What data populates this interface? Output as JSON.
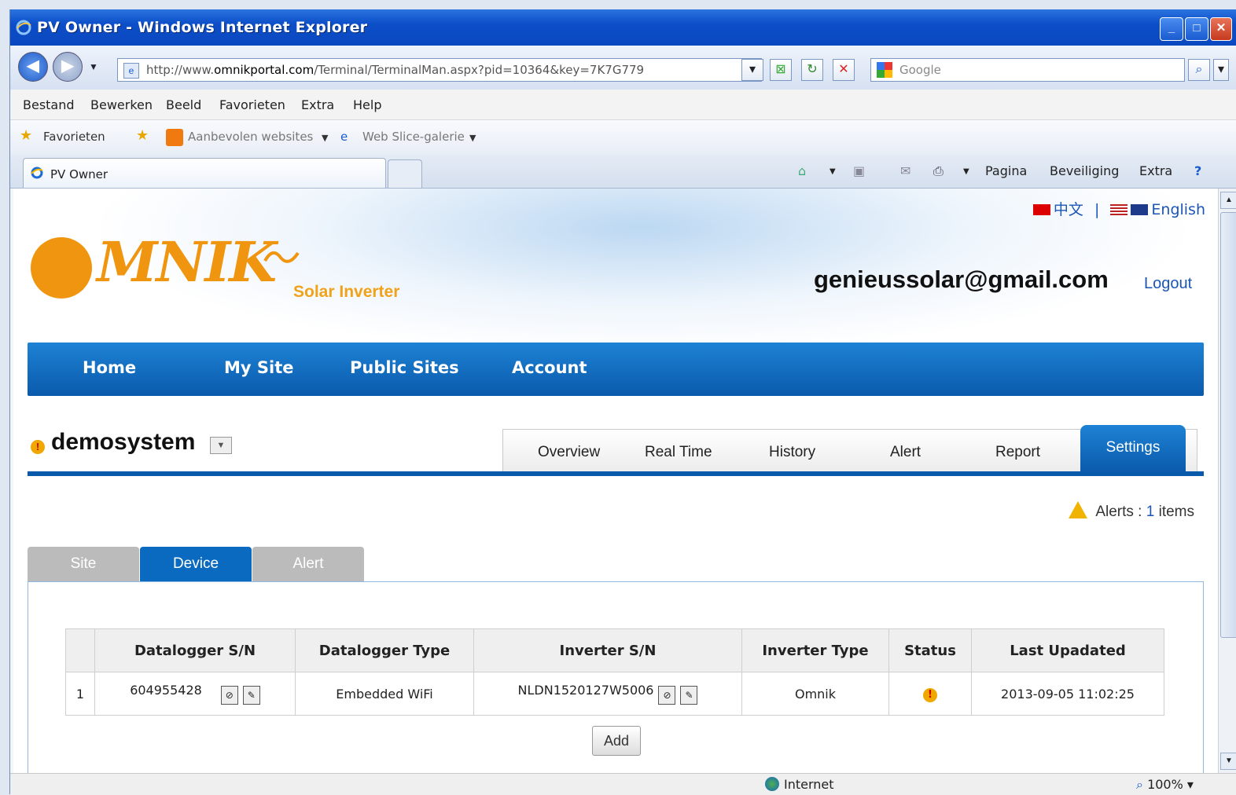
{
  "window": {
    "title": "PV Owner - Windows Internet Explorer"
  },
  "address": {
    "url_pre": "http://www.",
    "url_domain": "omnikportal.com",
    "url_post": "/Terminal/TerminalMan.aspx?pid=10364&key=7K7G779",
    "search_placeholder": "Google"
  },
  "menubar": {
    "items": [
      "Bestand",
      "Bewerken",
      "Beeld",
      "Favorieten",
      "Extra",
      "Help"
    ]
  },
  "favbar": {
    "favorites": "Favorieten",
    "suggested": "Aanbevolen websites",
    "webslice": "Web Slice-galerie"
  },
  "tabbar": {
    "tab_title": "PV Owner",
    "pagina": "Pagina",
    "beveiliging": "Beveiliging",
    "extra": "Extra"
  },
  "site": {
    "lang_cn": "中文",
    "lang_sep": "|",
    "lang_en": "English",
    "logo_text": "MNIK",
    "logo_sub": "Solar Inverter",
    "user_email": "genieussolar@gmail.com",
    "logout": "Logout",
    "nav": [
      "Home",
      "My Site",
      "Public Sites",
      "Account"
    ],
    "system_name": "demosystem",
    "section_tabs": [
      "Overview",
      "Real Time",
      "History",
      "Alert",
      "Report",
      "Settings"
    ],
    "alerts_label": "Alerts :",
    "alerts_count": "1",
    "alerts_items": "items",
    "sub_tabs": [
      "Site",
      "Device",
      "Alert"
    ],
    "table": {
      "headers": [
        "",
        "Datalogger S/N",
        "Datalogger Type",
        "Inverter S/N",
        "Inverter Type",
        "Status",
        "Last Upadated"
      ],
      "rows": [
        {
          "index": "1",
          "datalogger_sn": "604955428",
          "datalogger_type": "Embedded WiFi",
          "inverter_sn": "NLDN1520127W5006",
          "inverter_type": "Omnik",
          "last_updated": "2013-09-05 11:02:25"
        }
      ]
    },
    "add_button": "Add"
  },
  "statusbar": {
    "zone": "Internet",
    "zoom": "100%"
  },
  "colors": {
    "brand_orange": "#f0950f",
    "nav_blue": "#0a5aac",
    "link_blue": "#1b56b5"
  }
}
